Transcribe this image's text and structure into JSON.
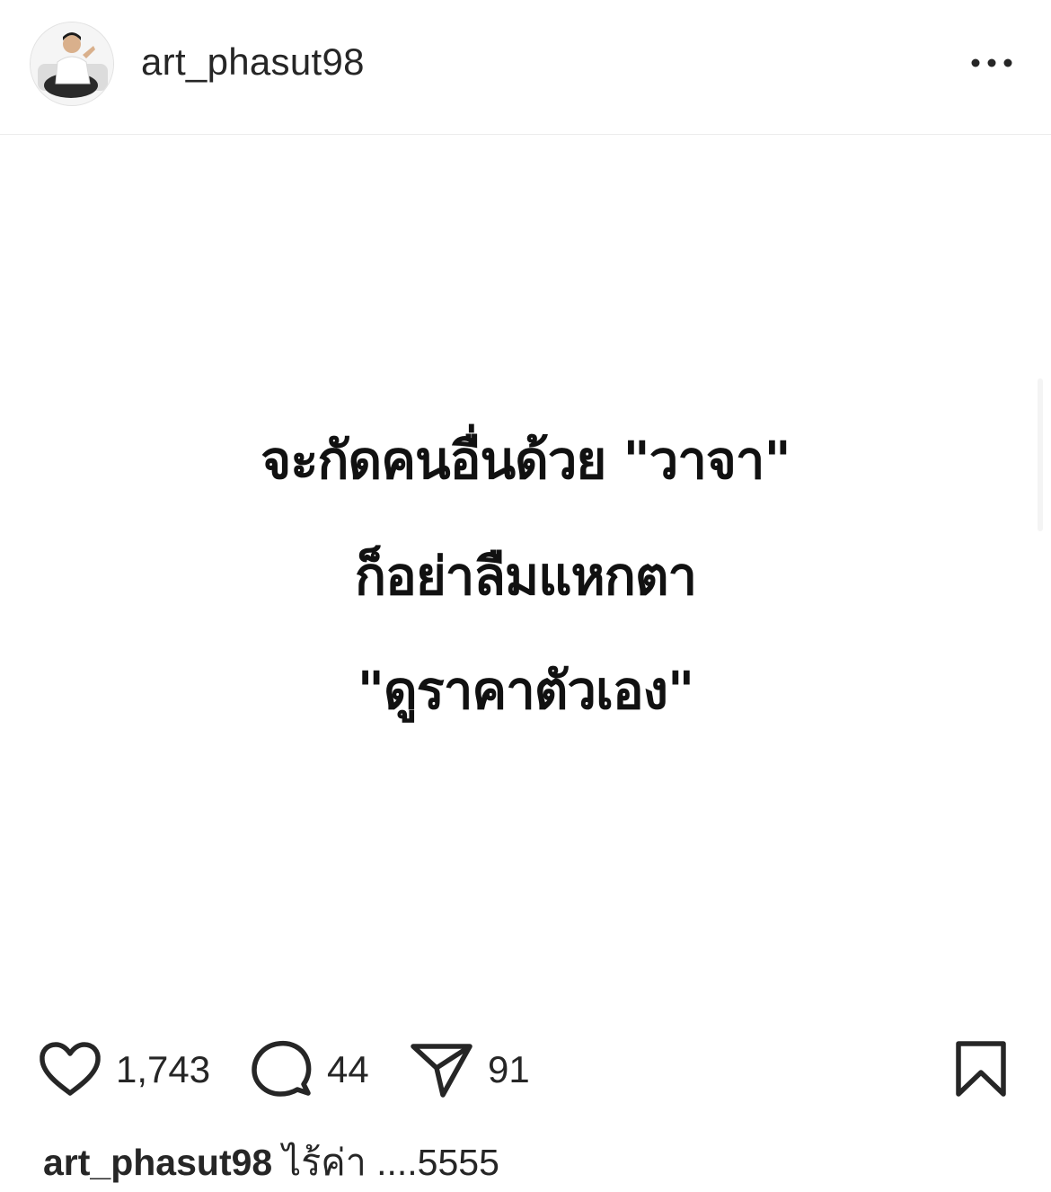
{
  "header": {
    "username": "art_phasut98",
    "more_icon": "more-horizontal-icon"
  },
  "post": {
    "text_lines": [
      "จะกัดคนอื่นด้วย \"วาจา\"",
      "ก็อย่าลืมแหกตา",
      "\"ดูราคาตัวเอง\""
    ]
  },
  "actions": {
    "like_icon": "heart-icon",
    "likes": "1,743",
    "comment_icon": "comment-bubble-icon",
    "comments": "44",
    "share_icon": "paper-plane-icon",
    "shares": "91",
    "save_icon": "bookmark-icon"
  },
  "caption": {
    "username": "art_phasut98",
    "text": "ไร้ค่า ....5555"
  }
}
